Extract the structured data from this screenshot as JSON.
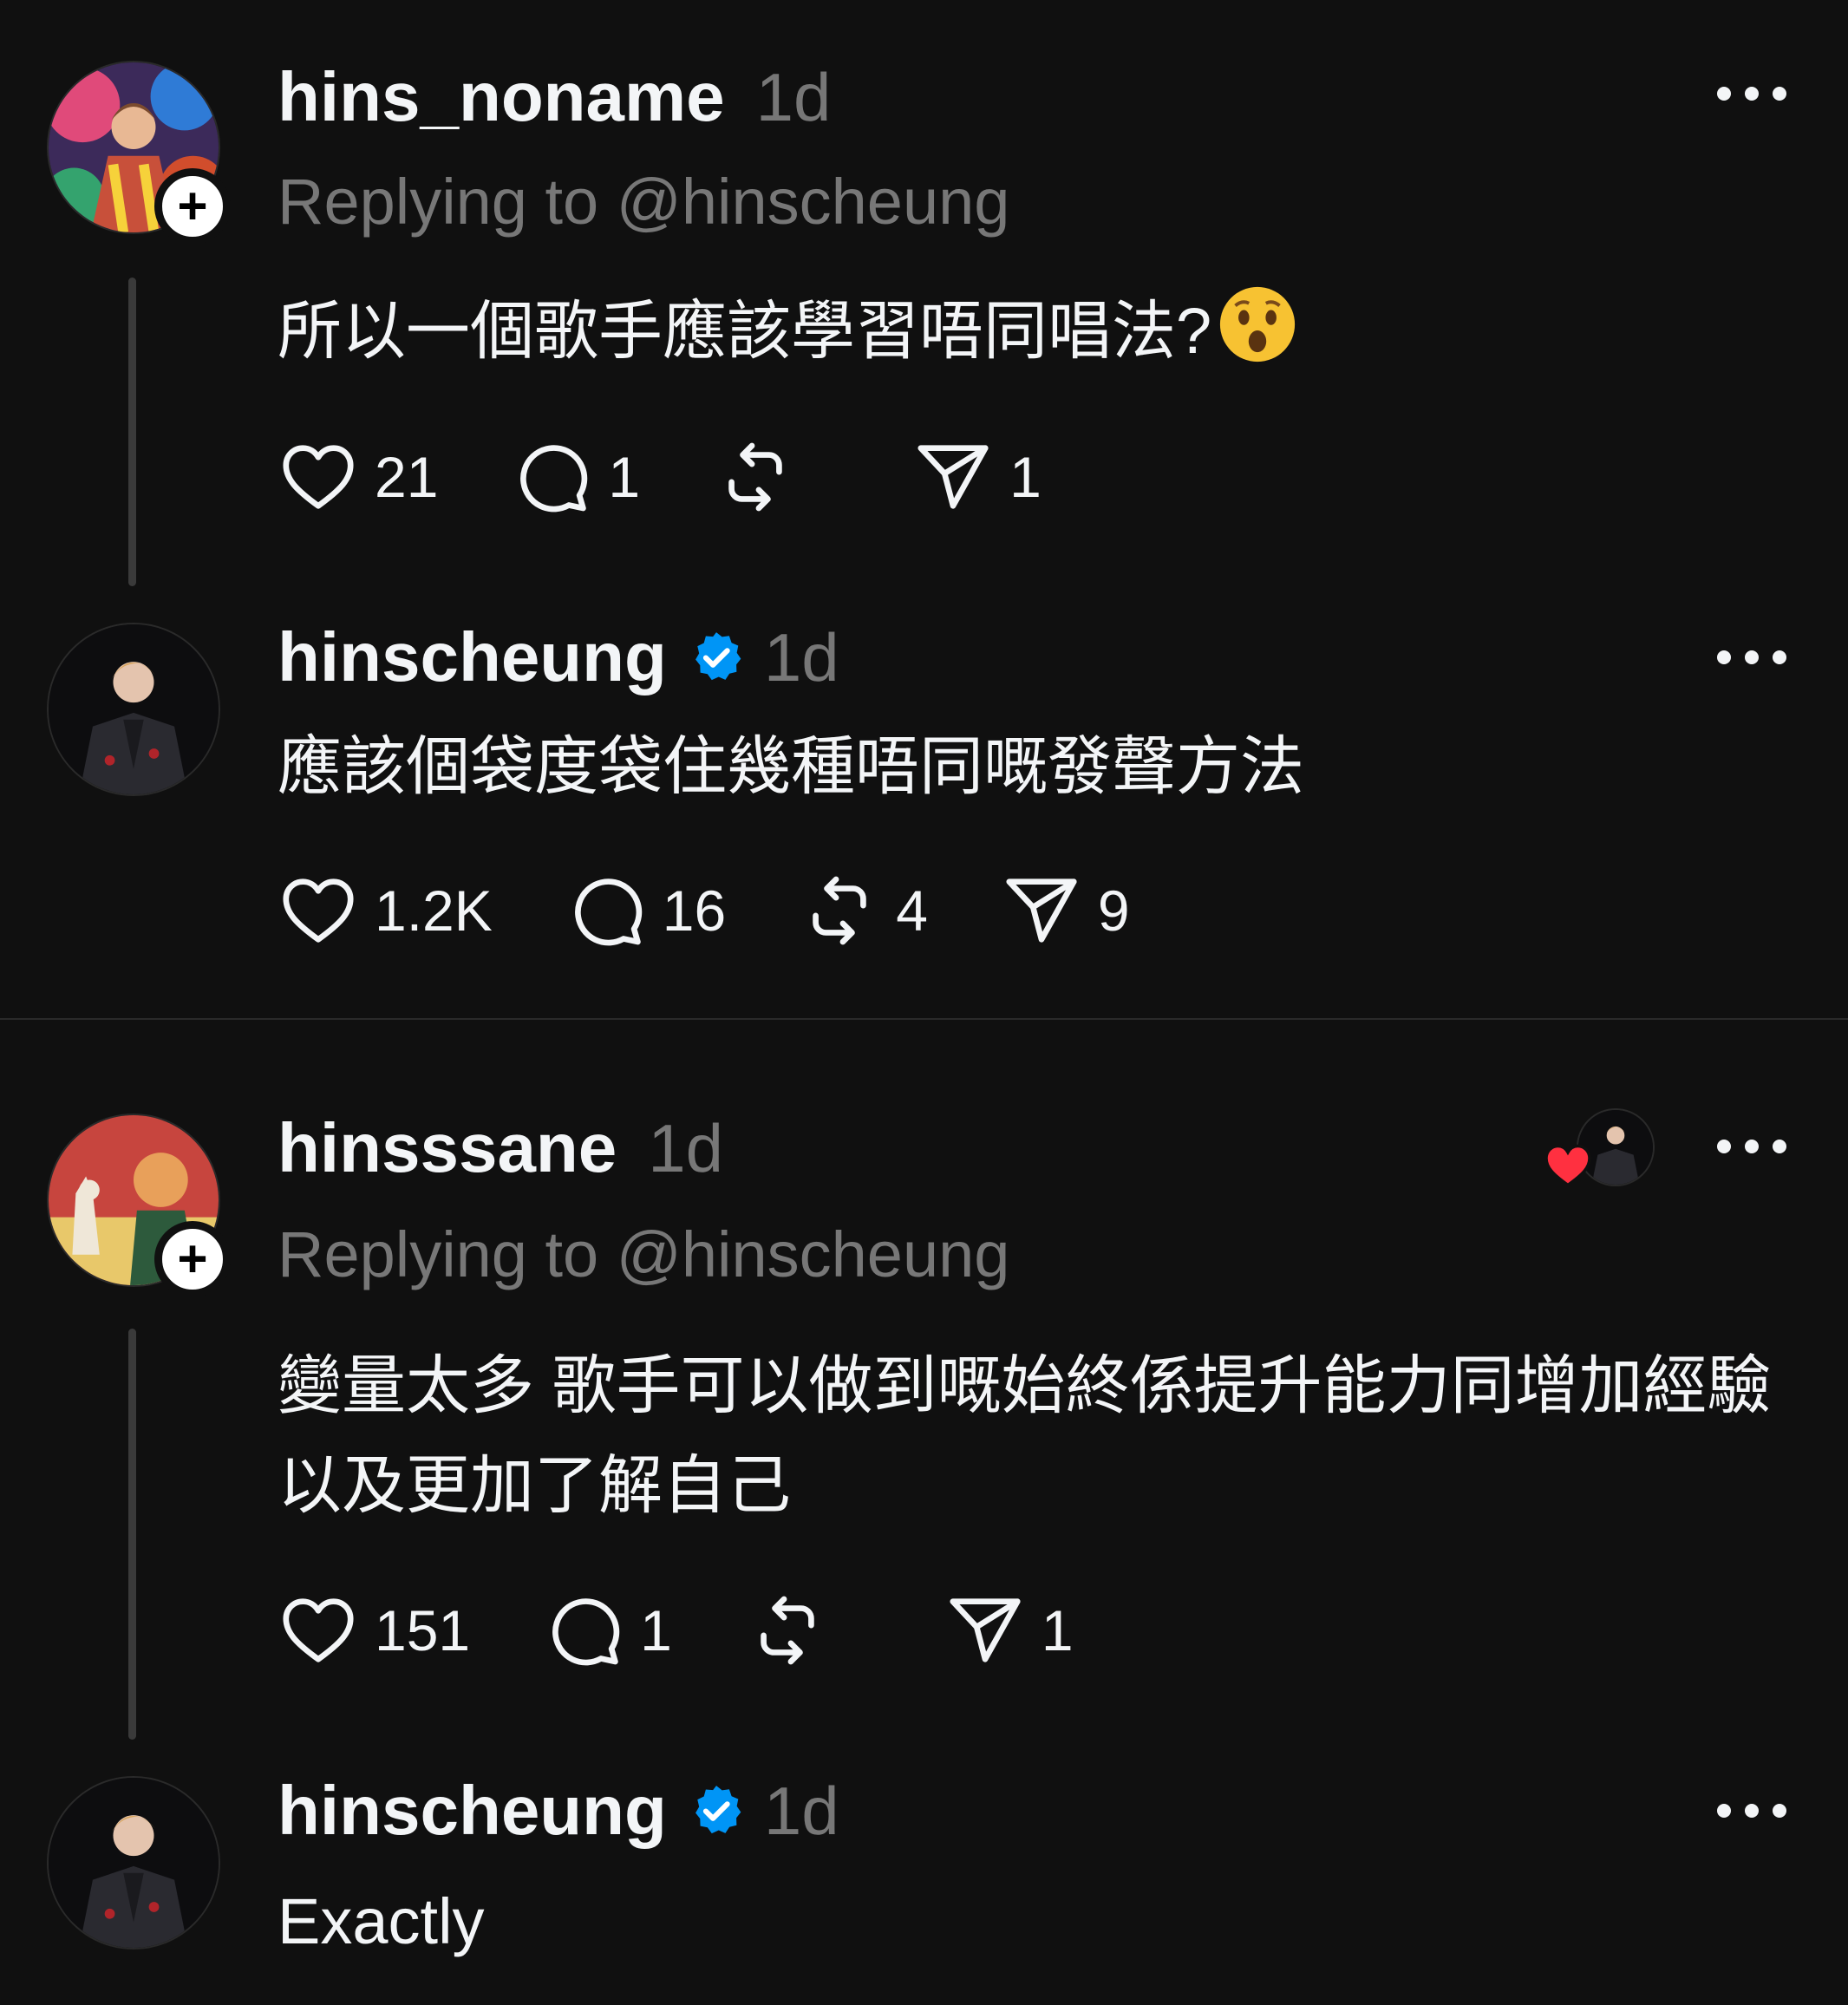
{
  "posts": [
    {
      "username": "hins_noname",
      "time": "1d",
      "reply_to": "Replying to @hinscheung",
      "text": "所以一個歌手應該學習唔同唱法?",
      "emoji": "hushed-face",
      "likes": "21",
      "replies": "1",
      "reposts": "",
      "shares": "1"
    },
    {
      "username": "hinscheung",
      "verified": true,
      "time": "1d",
      "text": "應該個袋度袋住幾種唔同嘅發聲方法",
      "likes": "1.2K",
      "replies": "16",
      "reposts": "4",
      "shares": "9"
    },
    {
      "username": "hinsssane",
      "time": "1d",
      "reply_to": "Replying to @hinscheung",
      "text": "變量太多 歌手可以做到嘅始終係提升能力同增加經驗 以及更加了解自己",
      "likes": "151",
      "replies": "1",
      "reposts": "",
      "shares": "1"
    },
    {
      "username": "hinscheung",
      "verified": true,
      "time": "1d",
      "text": "Exactly"
    }
  ],
  "icons": {
    "like": "heart-icon",
    "reply": "comment-icon",
    "repost": "repost-icon",
    "share": "send-icon",
    "more": "more-icon",
    "follow": "plus-icon",
    "verified": "verified-badge-icon",
    "liked_by_author": "heart-icon"
  },
  "colors": {
    "background": "#101010",
    "text": "#f3f5f7",
    "muted": "#777777",
    "verified": "#0095f6",
    "liked_heart": "#ff3040"
  }
}
